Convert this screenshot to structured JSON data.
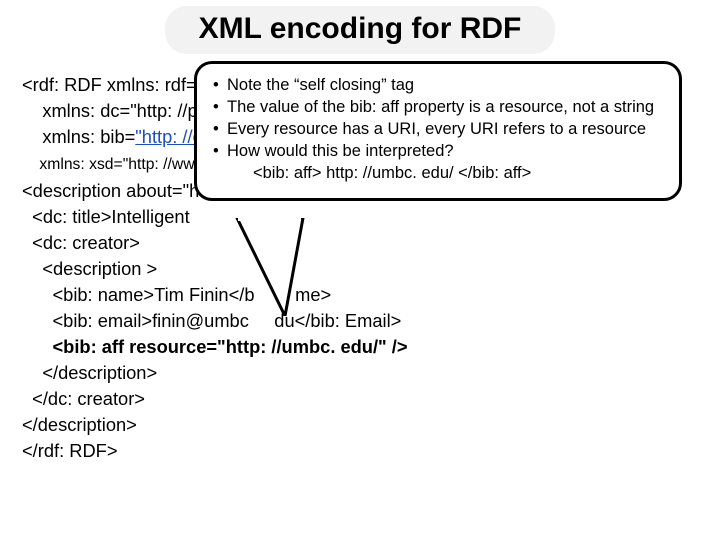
{
  "title": "XML encoding for RDF",
  "code": {
    "l1a": "<rdf: RDF xmlns: rdf=\"",
    "l2a": "    xmlns: dc=\"http: //pu",
    "l3a": "    xmlns: bib=",
    "l3b": "\"http: //d",
    "l4a": "    xmlns: xsd=\"http: //ww",
    "l5": "<description about=\"h",
    "l6": "  <dc: title>Intelligent ",
    "l7": "  <dc: creator>",
    "l8": "    <description >",
    "l9a": "      <bib: name>Tim Finin</b",
    "l9b": "me>",
    "l10a": "      <bib: email>finin@umbc",
    "l10b": "du</bib: Email>",
    "l11": "      <bib: aff resource=\"http: //umbc. edu/\" />",
    "l12": "    </description>",
    "l13": "  </dc: creator>",
    "l14": "</description>",
    "l15": "</rdf: RDF>"
  },
  "callout": {
    "b1": "Note the “self closing” tag",
    "b2": "The value of the bib: aff property is a resource, not a string",
    "b3": "Every resource has a URI, every URI refers to a resource",
    "b4": "How would this be interpreted?",
    "b4sub": "<bib: aff> http: //umbc. edu/ </bib: aff>"
  }
}
